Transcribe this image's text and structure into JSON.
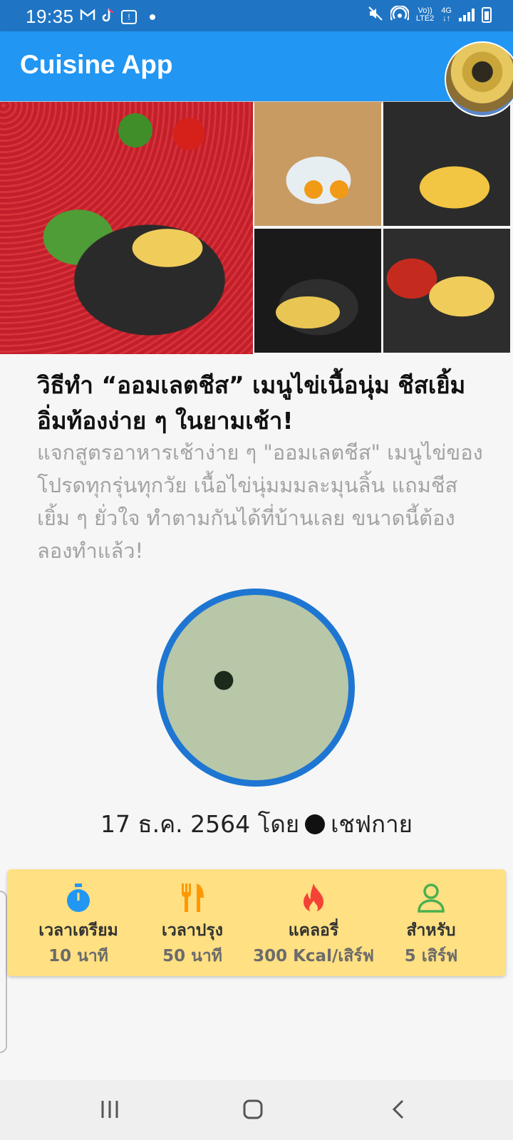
{
  "status_bar": {
    "time": "19:35",
    "icons": [
      "gmail-icon",
      "tiktok-icon",
      "notification-box-icon",
      "dot-icon",
      "mute-icon",
      "hotspot-icon",
      "volte-icon",
      "4g-icon",
      "signal-icon",
      "battery-icon"
    ],
    "network_top": "Vo)) ",
    "network_bottom": "LTE2",
    "network_type": "4G"
  },
  "app_bar": {
    "title": "Cuisine App",
    "color": "#2196F3"
  },
  "article": {
    "title": "วิธีทำ “ออมเลตชีส” เมนูไข่เนื้อนุ่ม ชีสเยิ้ม อิ่มท้องง่าย ๆ ในยามเช้า!",
    "description": "แจกสูตรอาหารเช้าง่าย ๆ \"ออมเลตชีส\" เมนูไข่ของโปรดทุกรุ่นทุกวัย เนื้อไข่นุ่มมมละมุนลิ้น แถมชีสเยิ้ม ๆ ยั่วใจ ทำตามกันได้ที่บ้านเลย ขนาดนี้ต้องลองทำแล้ว!"
  },
  "author": {
    "date": "17 ธ.ค. 2564",
    "by": "โดย",
    "name": "เชฟกาย",
    "ring_color": "#1E76D2"
  },
  "info": {
    "background": "#FFE082",
    "items": [
      {
        "icon": "stopwatch-icon",
        "label": "เวลาเตรียม",
        "value": "10 นาที",
        "color": "#2196F3"
      },
      {
        "icon": "fork-knife-icon",
        "label": "เวลาปรุง",
        "value": "50 นาที",
        "color": "#FF9800"
      },
      {
        "icon": "flame-icon",
        "label": "แคลอรี่",
        "value": "300 Kcal/เสิร์ฟ",
        "color": "#F44336"
      },
      {
        "icon": "person-icon",
        "label": "สำหรับ",
        "value": "5 เสิร์ฟ",
        "color": "#4CAF50"
      }
    ]
  },
  "nav_bar": {
    "buttons": [
      "recents-button",
      "home-button",
      "back-button"
    ]
  }
}
